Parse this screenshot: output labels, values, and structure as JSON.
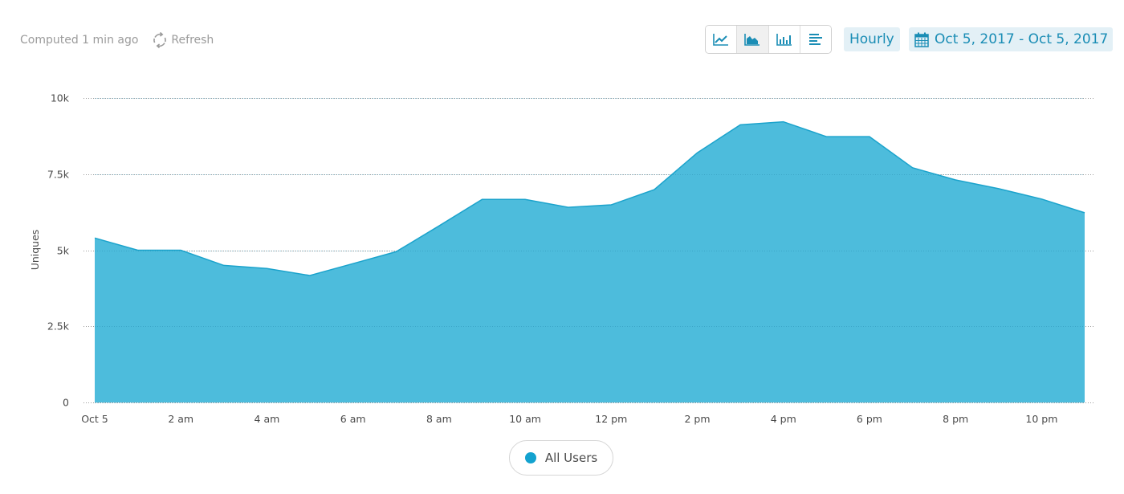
{
  "toolbar": {
    "computed_text": "Computed 1 min ago",
    "refresh_label": "Refresh",
    "refresh_icon": "refresh-icon",
    "chart_types": [
      {
        "name": "line",
        "icon": "line-chart-icon",
        "active": false
      },
      {
        "name": "area",
        "icon": "area-chart-icon",
        "active": true
      },
      {
        "name": "bar",
        "icon": "bar-chart-icon",
        "active": false
      },
      {
        "name": "table",
        "icon": "table-list-icon",
        "active": false
      }
    ],
    "interval_label": "Hourly",
    "date_range_label": "Oct 5, 2017 - Oct 5, 2017",
    "date_icon": "calendar-icon"
  },
  "colors": {
    "accent": "#1a8db5",
    "series_fill": "#4dbcdc",
    "series_line": "#1ba3cc",
    "legend_dot": "#13a2cf",
    "grid": "#9b9b9b"
  },
  "chart_data": {
    "type": "area",
    "title": "",
    "xlabel": "",
    "ylabel": "Uniques",
    "ylim": [
      0,
      10000
    ],
    "yticks": [
      0,
      2500,
      5000,
      7500,
      10000
    ],
    "ytick_labels": [
      "0",
      "2.5k",
      "5k",
      "7.5k",
      "10k"
    ],
    "x": [
      "Oct 5",
      "1 am",
      "2 am",
      "3 am",
      "4 am",
      "5 am",
      "6 am",
      "7 am",
      "8 am",
      "9 am",
      "10 am",
      "11 am",
      "12 pm",
      "1 pm",
      "2 pm",
      "3 pm",
      "4 pm",
      "5 pm",
      "6 pm",
      "7 pm",
      "8 pm",
      "9 pm",
      "10 pm",
      "11 pm"
    ],
    "xtick_labels": [
      "Oct 5",
      "2 am",
      "4 am",
      "6 am",
      "8 am",
      "10 am",
      "12 pm",
      "2 pm",
      "4 pm",
      "6 pm",
      "8 pm",
      "10 pm"
    ],
    "xtick_every": 2,
    "grid": true,
    "legend_position": "bottom-center",
    "series": [
      {
        "name": "All Users",
        "values": [
          5400,
          5000,
          5000,
          4500,
          4400,
          4170,
          4560,
          4950,
          5800,
          6670,
          6670,
          6410,
          6490,
          6990,
          8200,
          9120,
          9220,
          8730,
          8730,
          7710,
          7310,
          7020,
          6680,
          6230
        ]
      }
    ]
  }
}
